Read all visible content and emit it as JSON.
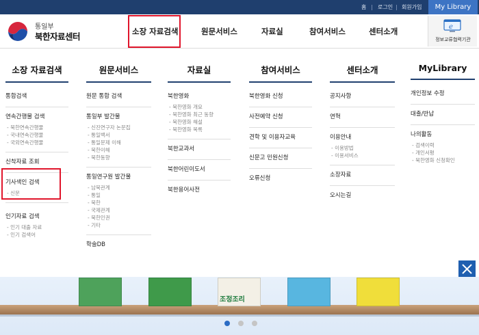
{
  "topbar": {
    "links": [
      "홈",
      "로그인",
      "회원가입"
    ],
    "mylibrary": "My Library"
  },
  "logo": {
    "ministry": "통일부",
    "center": "북한자료센터"
  },
  "gnb": [
    "소장 자료검색",
    "원문서비스",
    "자료실",
    "참여서비스",
    "센터소개"
  ],
  "partner": {
    "label": "정보교류협력기관"
  },
  "menu": {
    "columns": [
      {
        "title": "소장 자료검색",
        "groups": [
          {
            "label": "통합검색",
            "sub": []
          },
          {
            "label": "연속간행물 검색",
            "sub": [
              "북한연속간행물",
              "국내연속간행물",
              "국외연속간행물"
            ]
          },
          {
            "label": "신착자료 조회",
            "sub": []
          },
          {
            "label": "기사색인 검색",
            "sub": [
              "신문"
            ]
          },
          {
            "label": "인기자료 검색",
            "sub": [
              "인기 대출 자료",
              "인기 검색어"
            ]
          }
        ]
      },
      {
        "title": "원문서비스",
        "groups": [
          {
            "label": "원문 통합 검색",
            "sub": []
          },
          {
            "label": "통일부 발간물",
            "sub": [
              "신진연구자 논문집",
              "통일백서",
              "통일문제 이해",
              "북한이해",
              "북한동향"
            ]
          },
          {
            "label": "통일연구원 발간물",
            "sub": [
              "남북관계",
              "통일",
              "북한",
              "국제관계",
              "북한인권",
              "기타"
            ]
          },
          {
            "label": "학술DB",
            "sub": []
          }
        ]
      },
      {
        "title": "자료실",
        "groups": [
          {
            "label": "북한영화",
            "sub": [
              "북한영화 개요",
              "북한영화 최근 동향",
              "북한영화 해설",
              "북한영화 목록"
            ]
          },
          {
            "label": "북한교과서",
            "sub": []
          },
          {
            "label": "북한어린이도서",
            "sub": []
          },
          {
            "label": "북한용어사전",
            "sub": []
          }
        ]
      },
      {
        "title": "참여서비스",
        "groups": [
          {
            "label": "북한영화 신청",
            "sub": []
          },
          {
            "label": "사전예약 신청",
            "sub": []
          },
          {
            "label": "견학 및 이용자교육",
            "sub": []
          },
          {
            "label": "신문고 민원신청",
            "sub": []
          },
          {
            "label": "오류신청",
            "sub": []
          }
        ]
      },
      {
        "title": "센터소개",
        "groups": [
          {
            "label": "공지사항",
            "sub": []
          },
          {
            "label": "연혁",
            "sub": []
          },
          {
            "label": "이용안내",
            "sub": [
              "이용방법",
              "이용서비스"
            ]
          },
          {
            "label": "소장자료",
            "sub": []
          },
          {
            "label": "오시는길",
            "sub": []
          }
        ]
      },
      {
        "title": "MyLibrary",
        "groups": [
          {
            "label": "개인정보 수정",
            "sub": []
          },
          {
            "label": "대출/반납",
            "sub": []
          },
          {
            "label": "나의활동",
            "sub": [
              "검색이력",
              "개인서평",
              "북한영화 신청확인"
            ]
          }
        ]
      }
    ]
  },
  "banner": {
    "books": [
      {
        "color": "#4ea25b"
      },
      {
        "color": "#3f9a4a"
      },
      {
        "color": "#f3f0e6",
        "title": "조정조리"
      },
      {
        "color": "#58b6e0"
      },
      {
        "color": "#f0de3a"
      }
    ],
    "dots": 3,
    "active_dot": 0
  },
  "colors": {
    "navy": "#1f3f6e",
    "accent_blue": "#3d74c4",
    "highlight_red": "#e0142a"
  }
}
